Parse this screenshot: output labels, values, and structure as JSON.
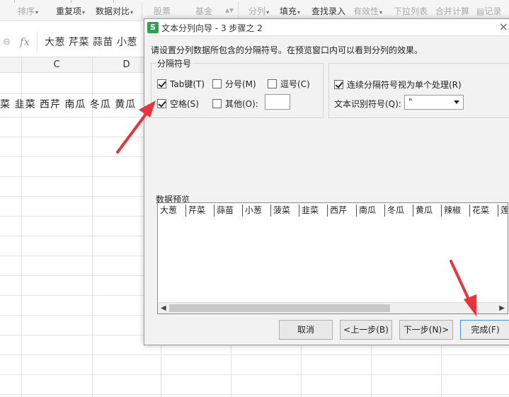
{
  "ribbon": {
    "items": [
      {
        "label": "排序",
        "caret": true,
        "gray": true
      },
      {
        "label": "重复项",
        "caret": true,
        "gray": false
      },
      {
        "label": "数据对比",
        "caret": true,
        "gray": false
      },
      {
        "label": "股票",
        "caret": false,
        "gray": true
      },
      {
        "label": "基金",
        "caret": false,
        "gray": true
      },
      {
        "label": "分列",
        "caret": true,
        "gray": true
      },
      {
        "label": "填充",
        "caret": true,
        "gray": false
      },
      {
        "label": "查找录入",
        "caret": false,
        "gray": false
      },
      {
        "label": "有效性",
        "caret": true,
        "gray": true
      },
      {
        "label": "下拉列表",
        "caret": false,
        "gray": true
      },
      {
        "label": "合并计算",
        "caret": false,
        "gray": true
      },
      {
        "label": "记录",
        "caret": false,
        "gray": true
      }
    ]
  },
  "formula_bar": {
    "fx": "fx",
    "content": "大葱 芹菜 蒜苗 小葱"
  },
  "grid": {
    "columns": [
      "C",
      "D"
    ],
    "row_text": "菜 韭菜 西芹 南瓜 冬瓜 黄瓜"
  },
  "dialog": {
    "icon": "S",
    "title": "文本分列向导 - 3 步骤之 2",
    "close": "×",
    "instruction": "请设置分列数据所包含的分隔符号。在预览窗口内可以看到分列的效果。",
    "delimiter_group": "分隔符号",
    "delimiters": {
      "tab": {
        "label": "Tab键(T)",
        "checked": true
      },
      "semicolon": {
        "label": "分号(M)",
        "checked": false
      },
      "comma": {
        "label": "逗号(C)",
        "checked": false
      },
      "space": {
        "label": "空格(S)",
        "checked": true
      },
      "other": {
        "label": "其他(O):",
        "checked": false,
        "value": ""
      }
    },
    "consecutive": {
      "label": "连续分隔符号视为单个处理(R)",
      "checked": true
    },
    "qualifier_label": "文本识别符号(Q):",
    "qualifier_value": "\"",
    "preview_label": "数据预览",
    "preview_cells": [
      "大葱",
      "芹菜",
      "蒜苗",
      "小葱",
      "菠菜",
      "韭菜",
      "西芹",
      "南瓜",
      "冬瓜",
      "黄瓜",
      "辣椒",
      "花菜",
      "莲"
    ],
    "buttons": {
      "cancel": "取消",
      "back": "<上一步(B)",
      "next": "下一步(N)>",
      "finish": "完成(F)"
    }
  },
  "colors": {
    "accent_arrow": "#e8343a",
    "icon_green": "#2fa14c"
  }
}
